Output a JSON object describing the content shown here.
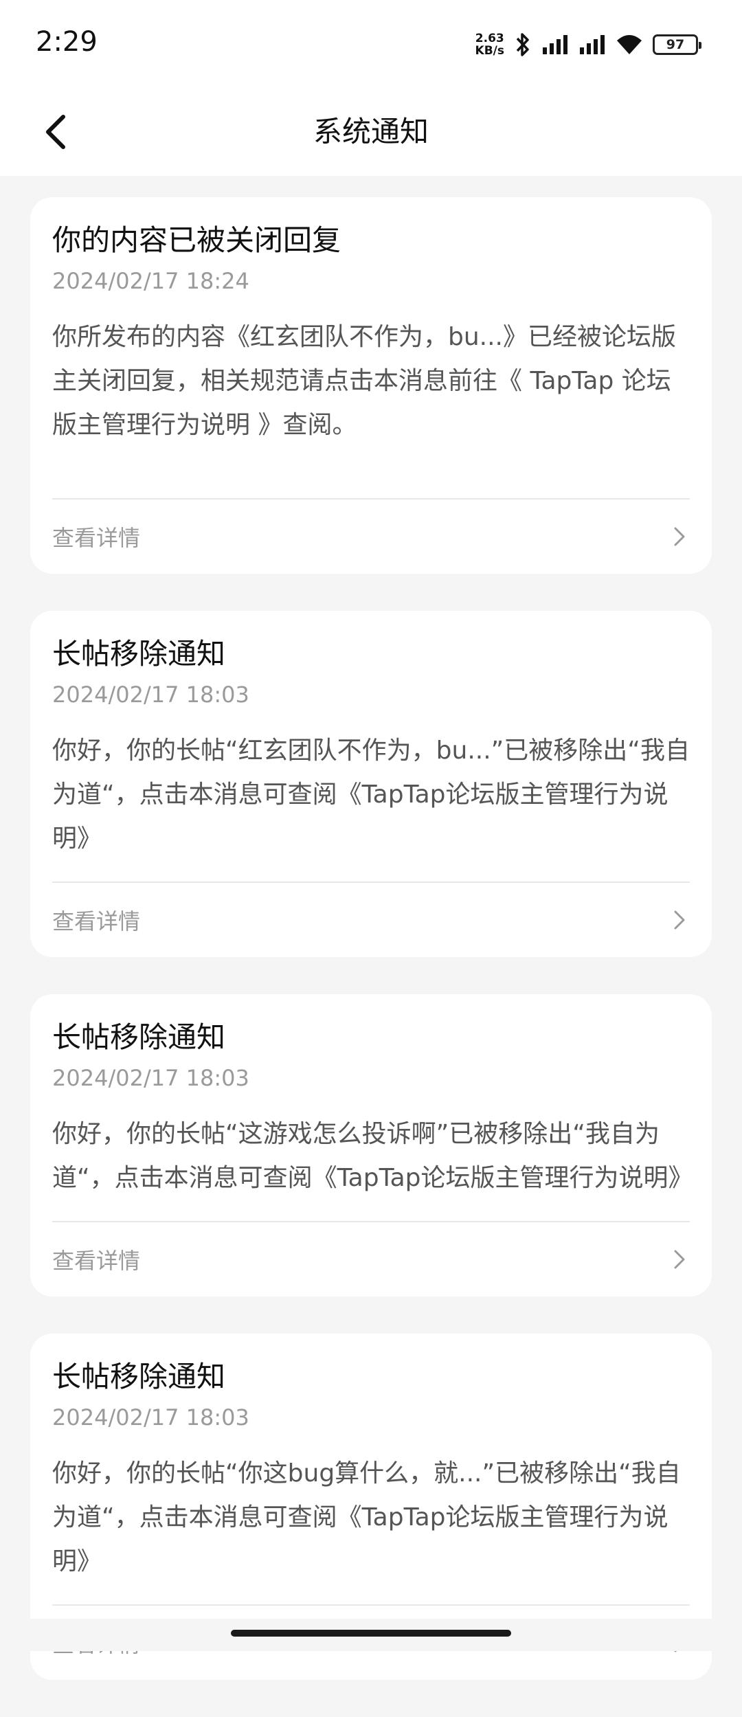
{
  "status_bar": {
    "time": "2:29",
    "net_speed_value": "2.63",
    "net_speed_unit": "KB/s",
    "battery": "97",
    "icons": [
      "bluetooth-icon",
      "signal-icon",
      "signal-icon",
      "wifi-icon",
      "battery-icon"
    ]
  },
  "header": {
    "title": "系统通知",
    "back_icon": "chevron-left-icon"
  },
  "notifications": [
    {
      "title": "你的内容已被关闭回复",
      "time": "2024/02/17 18:24",
      "body": "你所发布的内容《红玄团队不作为，bu...》已经被论坛版主关闭回复，相关规范请点击本消息前往《 TapTap 论坛版主管理行为说明 》查阅。",
      "detail_label": "查看详情"
    },
    {
      "title": "长帖移除通知",
      "time": "2024/02/17 18:03",
      "body": "你好，你的长帖“红玄团队不作为，bu...”已被移除出“我自为道“，点击本消息可查阅《TapTap论坛版主管理行为说明》",
      "detail_label": "查看详情"
    },
    {
      "title": "长帖移除通知",
      "time": "2024/02/17 18:03",
      "body": "你好，你的长帖“这游戏怎么投诉啊”已被移除出“我自为道“，点击本消息可查阅《TapTap论坛版主管理行为说明》",
      "detail_label": "查看详情"
    },
    {
      "title": "长帖移除通知",
      "time": "2024/02/17 18:03",
      "body": "你好，你的长帖“你这bug算什么，就...”已被移除出“我自为道“，点击本消息可查阅《TapTap论坛版主管理行为说明》",
      "detail_label": "查看详情"
    }
  ]
}
